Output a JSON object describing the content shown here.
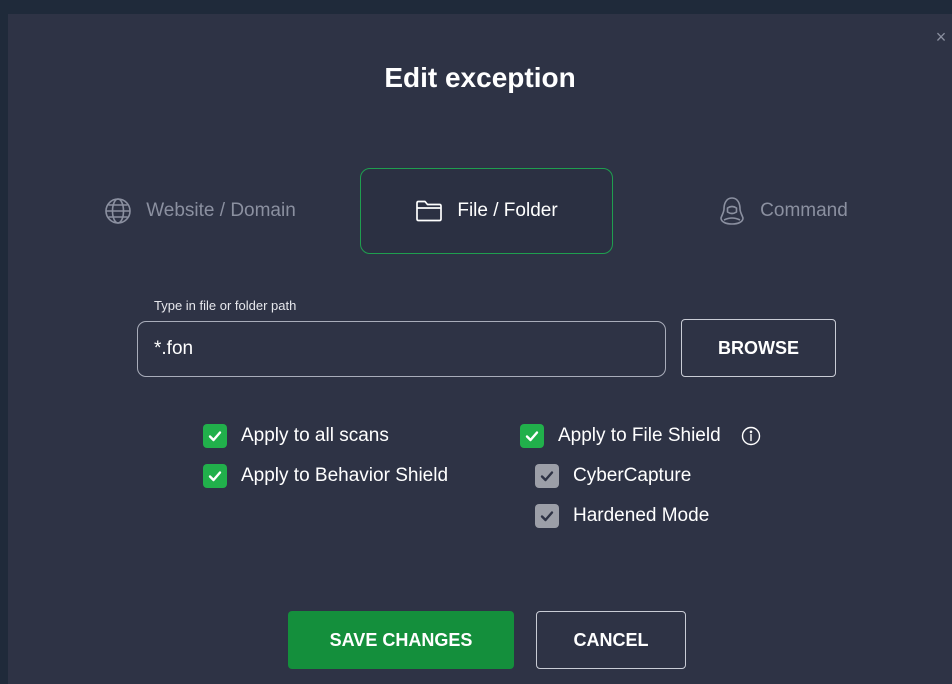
{
  "dialog": {
    "title": "Edit exception",
    "close_icon": "close-icon"
  },
  "tabs": [
    {
      "label": "Website / Domain",
      "icon": "globe-icon",
      "selected": false
    },
    {
      "label": "File / Folder",
      "icon": "folder-icon",
      "selected": true
    },
    {
      "label": "Command",
      "icon": "hacker-icon",
      "selected": false
    }
  ],
  "path": {
    "label": "Type in file or folder path",
    "value": "*.fon",
    "browse_label": "BROWSE"
  },
  "options": {
    "apply_all_scans": {
      "label": "Apply to all scans",
      "checked": true
    },
    "apply_behavior_shield": {
      "label": "Apply to Behavior Shield",
      "checked": true
    },
    "apply_file_shield": {
      "label": "Apply to File Shield",
      "checked": true
    },
    "cybercapture": {
      "label": "CyberCapture",
      "checked": true
    },
    "hardened_mode": {
      "label": "Hardened Mode",
      "checked": true
    }
  },
  "actions": {
    "save_label": "SAVE CHANGES",
    "cancel_label": "CANCEL"
  },
  "colors": {
    "accent_green": "#21b04b",
    "save_green": "#148f3c",
    "dialog_bg": "#2e3345",
    "checkbox_gray": "#9c9fa8"
  }
}
